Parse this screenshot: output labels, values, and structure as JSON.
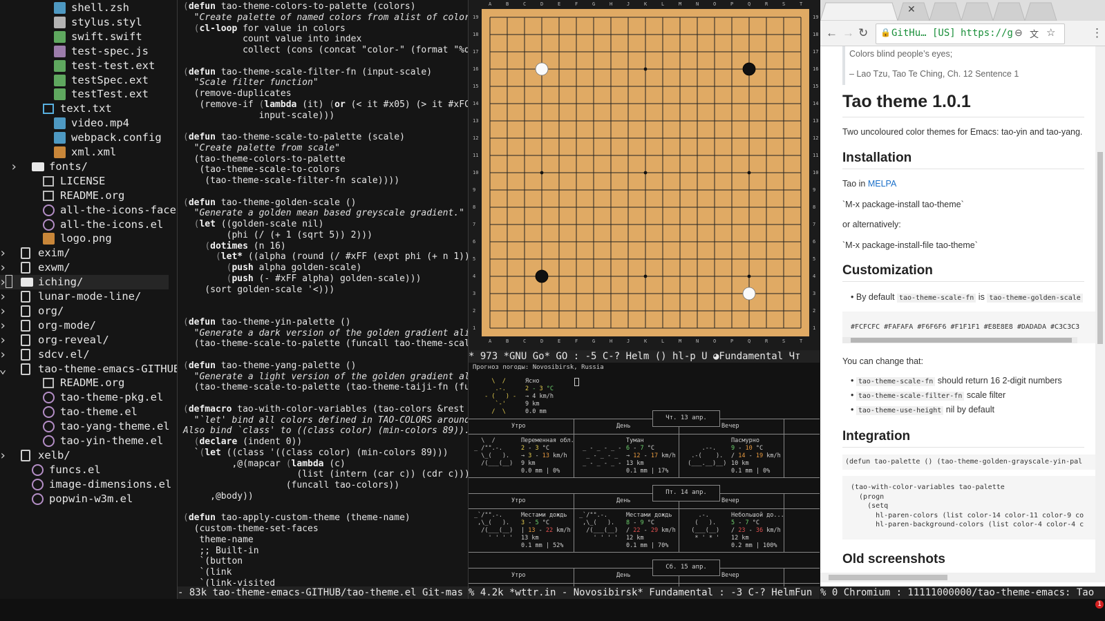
{
  "tree": {
    "items": [
      {
        "label": "shell.zsh",
        "indent": 3,
        "icon": "terminal-icon",
        "color": "#58b0e0"
      },
      {
        "label": "stylus.styl",
        "indent": 3,
        "icon": "stylus-icon",
        "color": "#cfcfcf"
      },
      {
        "label": "swift.swift",
        "indent": 3,
        "icon": "swift-icon",
        "color": "#6cc26c"
      },
      {
        "label": "test-spec.js",
        "indent": 3,
        "icon": "test-icon",
        "color": "#b48ec6"
      },
      {
        "label": "test-test.ext",
        "indent": 3,
        "icon": "flask-icon",
        "color": "#6cc26c"
      },
      {
        "label": "testSpec.ext",
        "indent": 3,
        "icon": "flask-icon",
        "color": "#6cc26c"
      },
      {
        "label": "testTest.ext",
        "indent": 3,
        "icon": "flask-icon",
        "color": "#6cc26c"
      },
      {
        "label": "text.txt",
        "indent": 2,
        "icon": "doc-icon",
        "color": "#58b0e0"
      },
      {
        "label": "video.mp4",
        "indent": 3,
        "icon": "film-icon",
        "color": "#58b0e0"
      },
      {
        "label": "webpack.config",
        "indent": 3,
        "icon": "webpack-icon",
        "color": "#58b0e0"
      },
      {
        "label": "xml.xml",
        "indent": 3,
        "icon": "xml-icon",
        "color": "#e89a40"
      },
      {
        "label": "fonts/",
        "indent": 1,
        "icon": "folder-icon",
        "arrow": ">"
      },
      {
        "label": "LICENSE",
        "indent": 2,
        "icon": "doc-icon",
        "color": "#bcbcbc"
      },
      {
        "label": "README.org",
        "indent": 2,
        "icon": "doc-icon",
        "color": "#bcbcbc"
      },
      {
        "label": "all-the-icons-faces.e",
        "indent": 2,
        "icon": "emacs-icon"
      },
      {
        "label": "all-the-icons.el",
        "indent": 2,
        "icon": "emacs-icon"
      },
      {
        "label": "logo.png",
        "indent": 2,
        "icon": "image-icon",
        "color": "#e89a40"
      },
      {
        "label": "exim/",
        "indent": 0,
        "icon": "repo-icon",
        "arrow": ">"
      },
      {
        "label": "exwm/",
        "indent": 0,
        "icon": "repo-icon",
        "arrow": ">"
      },
      {
        "label": "iching/",
        "indent": 0,
        "icon": "folder-icon",
        "arrow": ">",
        "selected": true
      },
      {
        "label": "lunar-mode-line/",
        "indent": 0,
        "icon": "repo-icon",
        "arrow": ">"
      },
      {
        "label": "org/",
        "indent": 0,
        "icon": "repo-icon",
        "arrow": ">"
      },
      {
        "label": "org-mode/",
        "indent": 0,
        "icon": "repo-icon",
        "arrow": ">"
      },
      {
        "label": "org-reveal/",
        "indent": 0,
        "icon": "repo-icon",
        "arrow": ">"
      },
      {
        "label": "sdcv.el/",
        "indent": 0,
        "icon": "repo-icon",
        "arrow": ">"
      },
      {
        "label": "tao-theme-emacs-GITHUB/",
        "indent": 0,
        "icon": "repo-icon",
        "arrow": "v"
      },
      {
        "label": "README.org",
        "indent": 2,
        "icon": "doc-icon",
        "color": "#bcbcbc"
      },
      {
        "label": "tao-theme-pkg.el",
        "indent": 2,
        "icon": "emacs-icon"
      },
      {
        "label": "tao-theme.el",
        "indent": 2,
        "icon": "emacs-icon"
      },
      {
        "label": "tao-yang-theme.el",
        "indent": 2,
        "icon": "emacs-icon"
      },
      {
        "label": "tao-yin-theme.el",
        "indent": 2,
        "icon": "emacs-icon"
      },
      {
        "label": "xelb/",
        "indent": 0,
        "icon": "repo-icon",
        "arrow": ">"
      },
      {
        "label": "funcs.el",
        "indent": 1,
        "icon": "emacs-icon"
      },
      {
        "label": "image-dimensions.el",
        "indent": 1,
        "icon": "emacs-icon"
      },
      {
        "label": "popwin-w3m.el",
        "indent": 1,
        "icon": "emacs-icon"
      }
    ]
  },
  "code": {
    "lines": [
      "(defun tao-theme-colors-to-palette (colors)",
      "  \"Create palette of named colors from alist of colors\"",
      "  (cl-loop for value in colors",
      "           count value into index",
      "           collect (cons (concat \"color-\" (format \"%d\" ind»",
      "",
      "(defun tao-theme-scale-filter-fn (input-scale)",
      "  \"Scale filter function\"",
      "  (remove-duplicates",
      "   (remove-if (lambda (it) (or (< it #x05) (> it #xFC)))",
      "              input-scale)))",
      "",
      "(defun tao-theme-scale-to-palette (scale)",
      "  \"Create palette from scale\"",
      "  (tao-theme-colors-to-palette",
      "   (tao-theme-scale-to-colors",
      "    (tao-theme-scale-filter-fn scale))))",
      "",
      "(defun tao-theme-golden-scale ()",
      "  \"Generate a golden mean based greyscale gradient.\"",
      "  (let ((golden-scale nil)",
      "        (phi (/ (+ 1 (sqrt 5)) 2)))",
      "    (dotimes (n 16)",
      "      (let* ((alpha (round (/ #xFF (expt phi (+ n 1))))))",
      "        (push alpha golden-scale)",
      "        (push (- #xFF alpha) golden-scale)))",
      "    (sort golden-scale '<)))",
      "",
      "",
      "(defun tao-theme-yin-palette ()",
      "  \"Generate a dark version of the golden gradient alist.\" »",
      "  (tao-theme-scale-to-palette (funcall tao-theme-scale-fn)»",
      "",
      "(defun tao-theme-yang-palette ()",
      "  \"Generate a light version of the golden gradient alist.\"»",
      "  (tao-theme-scale-to-palette (tao-theme-taiji-fn (funcall»",
      "",
      "(defmacro tao-with-color-variables (tao-colors &rest body)»",
      "  \"`let' bind all colors defined in TAO-COLORS around BODY»",
      "Also bind `class' to ((class color) (min-colors 89)).\"",
      "  (declare (indent 0))",
      "  `(let ((class '((class color) (min-colors 89)))",
      "         ,@(mapcar (lambda (c)",
      "                     (list (intern (car c)) (cdr c)))",
      "                   (funcall tao-colors))",
      "     ,@body))",
      "",
      "(defun tao-apply-custom-theme (theme-name)",
      "  (custom-theme-set-faces",
      "   theme-name",
      "   ;; Built-in",
      "   `(button                                          ((t »",
      "   `(link                                            ((t »",
      "   `(link-visited                                    ((t »"
    ]
  },
  "go": {
    "columns": [
      "A",
      "B",
      "C",
      "D",
      "E",
      "F",
      "G",
      "H",
      "J",
      "K",
      "L",
      "M",
      "N",
      "O",
      "P",
      "Q",
      "R",
      "S",
      "T"
    ],
    "rows": [
      "19",
      "18",
      "17",
      "16",
      "15",
      "14",
      "13",
      "12",
      "11",
      "10",
      "9",
      "8",
      "7",
      "6",
      "5",
      "4",
      "3",
      "2",
      "1"
    ],
    "stones": [
      {
        "point": "D16",
        "color": "white"
      },
      {
        "point": "Q16",
        "color": "black"
      },
      {
        "point": "D4",
        "color": "black"
      },
      {
        "point": "Q3",
        "color": "white"
      }
    ],
    "hoshi": [
      "D16",
      "K16",
      "Q16",
      "D10",
      "K10",
      "Q10",
      "D4",
      "K4",
      "Q4"
    ],
    "board_color": "#e0aa64"
  },
  "modeline_go": "* 973  *GNU Go*  GO : -5 C-? Helm () hl-p U ◕Fundamental  Чт",
  "modeline_code": " - 83k  tao-theme-emacs-GITHUB/tao-theme.el  Git-mas",
  "modeline_wttr": "% 4.2k  *wttr.in - Novosibirsk*   Fundamental : -3 C-? HelmFun",
  "modeline_browser": "% 0  Chromium : 11111000000/tao-theme-emacs: Tao",
  "wttr": {
    "header": "Прогноз погоды: Novosibirsk, Russia",
    "now": {
      "art": "   \\  /\n    .-.\n - (   ) -\n    `-'\n   /  \\",
      "desc": "Ясно",
      "temp": "2 - 3 °C",
      "wind": "→ 4 km/h",
      "vis": "9 km",
      "precip": "0.0 mm"
    },
    "days": [
      {
        "date": "Чт. 13 апр.",
        "parts": [
          {
            "name": "Утро",
            "art": "  \\  /\n_ /\"\".-.\n  \\_(   ).\n  /(___(__)",
            "desc": "Переменная обл.",
            "temp": "2 - 3 °C",
            "wind": "→ 3 - 13 km/h",
            "vis": "9 km",
            "precip": "0.0 mm | 0%"
          },
          {
            "name": "День",
            "art": "\n _ - _ - _ -\n  _ - _ - _\n _ - _ - _ -",
            "desc": "Туман",
            "temp": "6 - 7 °C",
            "wind": "→ 12 - 17 km/h",
            "vis": "13 km",
            "precip": "0.1 mm | 17%"
          },
          {
            "name": "Вечер",
            "art": "\n     .--.\n  .-(    ).\n (___.__)__)",
            "desc": "Пасмурно",
            "temp": "9 - 10 °C",
            "wind": "/ 14 - 19 km/h",
            "vis": "10 km",
            "precip": "0.1 mm | 0%"
          }
        ]
      },
      {
        "date": "Пт. 14 апр.",
        "parts": [
          {
            "name": "Утро",
            "art": "_`/\"\".-.\n ,\\_(   ).\n  /(___(__)\n    ' ' ' '",
            "desc": "Местами дождь",
            "temp": "3 - 5 °C",
            "wind": "| 13 - 22 km/h",
            "vis": "13 km",
            "precip": "0.1 mm | 52%"
          },
          {
            "name": "День",
            "art": "_`/\"\".-.\n ,\\_(   ).\n  /(___(__)\n    ' ' ' '",
            "desc": "Местами дождь",
            "temp": "8 - 9 °C",
            "wind": "/ 22 - 29 km/h",
            "vis": "12 km",
            "precip": "0.1 mm | 70%"
          },
          {
            "name": "Вечер",
            "art": "    .-.\n   (   ).\n  (___(__)\n   * ' * '",
            "desc": "Небольшой до...",
            "temp": "5 - 7 °C",
            "wind": "/ 23 - 36 km/h",
            "vis": "12 km",
            "precip": "0.2 mm | 100%"
          }
        ]
      },
      {
        "date": "Сб. 15 апр.",
        "parts": [
          {
            "name": "Утро"
          },
          {
            "name": "День"
          },
          {
            "name": "Вечер"
          }
        ]
      }
    ]
  },
  "browser": {
    "tab_title": "",
    "url_secure": "GitHu… [US]",
    "url": "https://g",
    "quote_1": "Colors blind people’s eyes;",
    "quote_2": "– Lao Tzu, Tao Te Ching, Ch. 12 Sentence 1",
    "title": "Tao theme 1.0.1",
    "intro": "Two uncoloured color themes for Emacs: tao-yin and tao-yang.",
    "h_install": "Installation",
    "tao_in": "Tao in",
    "melpa": "MELPA",
    "install_1": "`M-x package-install tao-theme`",
    "or_alt": "or alternatively:",
    "install_2": "`M-x package-install-file tao-theme`",
    "h_custom": "Customization",
    "by_default": "By default",
    "scale_fn": "tao-theme-scale-fn",
    "is": "is",
    "golden_scale": "tao-theme-golden-scale",
    "hex_line": "#FCFCFC #FAFAFA #F6F6F6 #F1F1F1 #E8E8E8 #DADADA #C3C3C3",
    "change_that": "You can change that:",
    "bullets": [
      {
        "code": "tao-theme-scale-fn",
        "text": "should return 16 2-digit numbers"
      },
      {
        "code": "tao-theme-scale-filter-fn",
        "text": "scale filter"
      },
      {
        "code": "tao-theme-use-height",
        "text": "nil by default"
      }
    ],
    "h_integration": "Integration",
    "int_line": "(defun tao-palette () (tao-theme-golden-grayscale-yin-pal",
    "int_block": "(tao-with-color-variables tao-palette\n  (progn\n    (setq\n      hl-paren-colors (list color-14 color-11 color-9 co\n      hl-paren-background-colors (list color-4 color-4 c",
    "h_old": "Old screenshots"
  },
  "notification_count": "1"
}
